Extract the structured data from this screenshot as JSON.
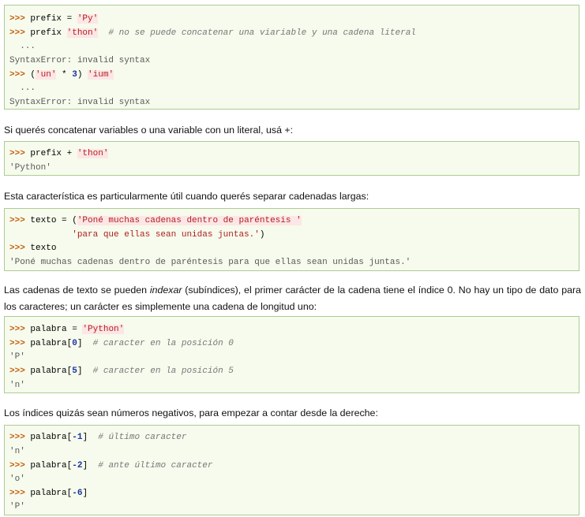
{
  "block1": {
    "l1": {
      "prompt": ">>>",
      "code": " prefix = ",
      "str": "'Py'"
    },
    "l2": {
      "prompt": ">>>",
      "code": " prefix ",
      "str": "'thon'",
      "comment": "  # no se puede concatenar una viariable y una cadena literal"
    },
    "l3": {
      "text": "  ..."
    },
    "l4": {
      "text": "SyntaxError: invalid syntax"
    },
    "l5": {
      "prompt": ">>>",
      "a": " (",
      "s1": "'un'",
      "b": " * ",
      "n": "3",
      "c": ") ",
      "s2": "'ium'"
    },
    "l6": {
      "text": "  ..."
    },
    "l7": {
      "text": "SyntaxError: invalid syntax"
    }
  },
  "para1": {
    "text": "Si querés concatenar variables o una variable con un literal, usá +:"
  },
  "block2": {
    "l1": {
      "prompt": ">>>",
      "code": " prefix + ",
      "str": "'thon'"
    },
    "l2": {
      "text": "'Python'"
    }
  },
  "para2": {
    "text": "Esta característica es particularmente útil cuando querés separar cadenadas largas:"
  },
  "block3": {
    "l1": {
      "prompt": ">>>",
      "code": " texto = (",
      "str": "'Poné muchas cadenas dentro de paréntesis '"
    },
    "l2": {
      "indent": "            ",
      "str": "'para que ellas sean unidas juntas.'",
      "close": ")"
    },
    "l3": {
      "prompt": ">>>",
      "code": " texto"
    },
    "l4": {
      "text": "'Poné muchas cadenas dentro de paréntesis para que ellas sean unidas juntas.'"
    }
  },
  "para3": {
    "a": "Las cadenas de texto se pueden ",
    "em": "indexar",
    "b": " (subíndices), el primer carácter de la cadena tiene el índice 0. No hay un tipo de dato para los caracteres; un carácter es simplemente una cadena de longitud uno:"
  },
  "block4": {
    "l1": {
      "prompt": ">>>",
      "code": " palabra = ",
      "str": "'Python'"
    },
    "l2": {
      "prompt": ">>>",
      "a": " palabra[",
      "n": "0",
      "b": "]",
      "comment": "  # caracter en la posición 0"
    },
    "l3": {
      "text": "'P'"
    },
    "l4": {
      "prompt": ">>>",
      "a": " palabra[",
      "n": "5",
      "b": "]",
      "comment": "  # caracter en la posición 5"
    },
    "l5": {
      "text": "'n'"
    }
  },
  "para4": {
    "text": "Los índices quizás sean números negativos, para empezar a contar desde la dereche:"
  },
  "block5": {
    "l1": {
      "prompt": ">>>",
      "a": " palabra[",
      "n": "-1",
      "b": "]",
      "comment": "  # último caracter"
    },
    "l2": {
      "text": "'n'"
    },
    "l3": {
      "prompt": ">>>",
      "a": " palabra[",
      "n": "-2",
      "b": "]",
      "comment": "  # ante último caracter"
    },
    "l4": {
      "text": "'o'"
    },
    "l5": {
      "prompt": ">>>",
      "a": " palabra[",
      "n": "-6",
      "b": "]"
    },
    "l6": {
      "text": "'P'"
    }
  }
}
